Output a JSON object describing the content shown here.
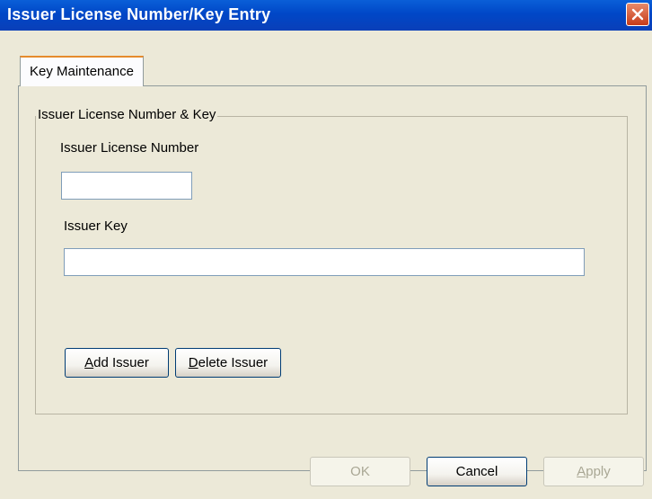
{
  "window": {
    "title": "Issuer License Number/Key Entry"
  },
  "tabs": [
    {
      "label": "Key Maintenance"
    }
  ],
  "group": {
    "title": "Issuer License Number & Key",
    "license_label": "Issuer License Number",
    "license_value": "",
    "key_label": "Issuer Key",
    "key_value": "",
    "add_button": {
      "mnemonic": "A",
      "rest": "dd Issuer"
    },
    "delete_button": {
      "mnemonic": "D",
      "rest": "elete Issuer"
    }
  },
  "footer": {
    "ok_label": "OK",
    "cancel_label": "Cancel",
    "apply_mnemonic": "A",
    "apply_rest": "pply"
  },
  "icons": {
    "close": "close-icon"
  }
}
